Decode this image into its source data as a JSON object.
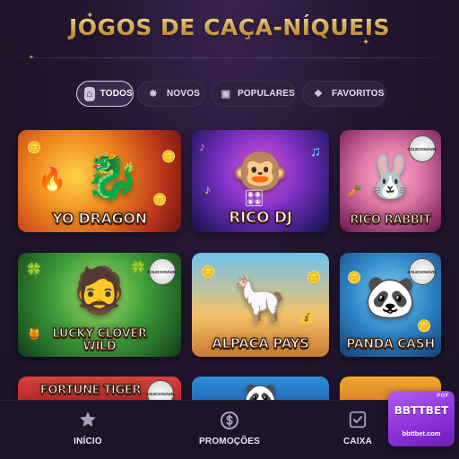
{
  "page_title": "JOGOS DE CAÇA-NÍQUEIS",
  "filters": [
    {
      "label": "TODOS",
      "icon": "home-icon",
      "active": true
    },
    {
      "label": "NOVOS",
      "icon": "new-badge-icon",
      "active": false
    },
    {
      "label": "POPULARES",
      "icon": "popular-flame-icon",
      "active": false
    },
    {
      "label": "FAVORITOS",
      "icon": "favorites-icon",
      "active": false
    }
  ],
  "games": [
    {
      "name": "YO DRAGON",
      "badge": ""
    },
    {
      "name": "RICO DJ",
      "badge": ""
    },
    {
      "name": "RICO RABBIT",
      "badge": "COLECIONÁVEL"
    },
    {
      "name": "LUCKY CLOVER\nWILD",
      "badge": "COLECIONÁVEL"
    },
    {
      "name": "ALPACA PAYS",
      "badge": ""
    },
    {
      "name": "PANDA CASH",
      "badge": "COLECIONÁVEL"
    },
    {
      "name": "FORTUNE TIGER",
      "badge": "COLECIONÁVEL"
    },
    {
      "name": "",
      "badge": ""
    },
    {
      "name": "",
      "badge": ""
    }
  ],
  "bottom_nav": {
    "home_label": "INÍCIO",
    "promotions_label": "PROMOÇÕES",
    "cashier_label": "CAIXA"
  },
  "brand": {
    "tag": "PGF",
    "name": "BBTTBET",
    "url": "bbttbet.com"
  },
  "colors": {
    "background": "#23162f",
    "title_gold": "#f3c15a",
    "brand_purple": "#8a2fd9"
  }
}
